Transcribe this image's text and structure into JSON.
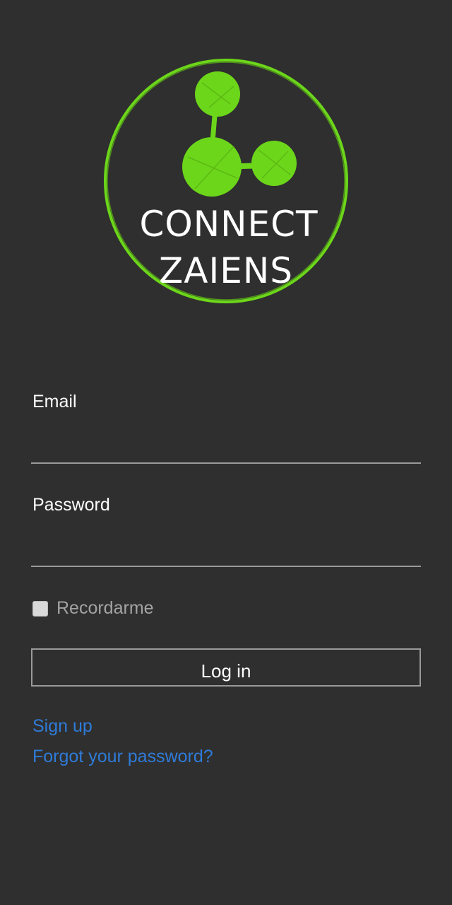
{
  "logo": {
    "line1": "CONNECT",
    "line2": "ZAIENS",
    "accent_color": "#6cd61a"
  },
  "form": {
    "email_label": "Email",
    "email_value": "",
    "password_label": "Password",
    "password_value": "",
    "remember_label": "Recordarme",
    "remember_checked": false,
    "login_label": "Log in"
  },
  "links": {
    "signup": "Sign up",
    "forgot": "Forgot your password?"
  },
  "colors": {
    "background": "#2f2f2f",
    "link": "#2f7bd8",
    "underline": "#9a9a9a"
  }
}
